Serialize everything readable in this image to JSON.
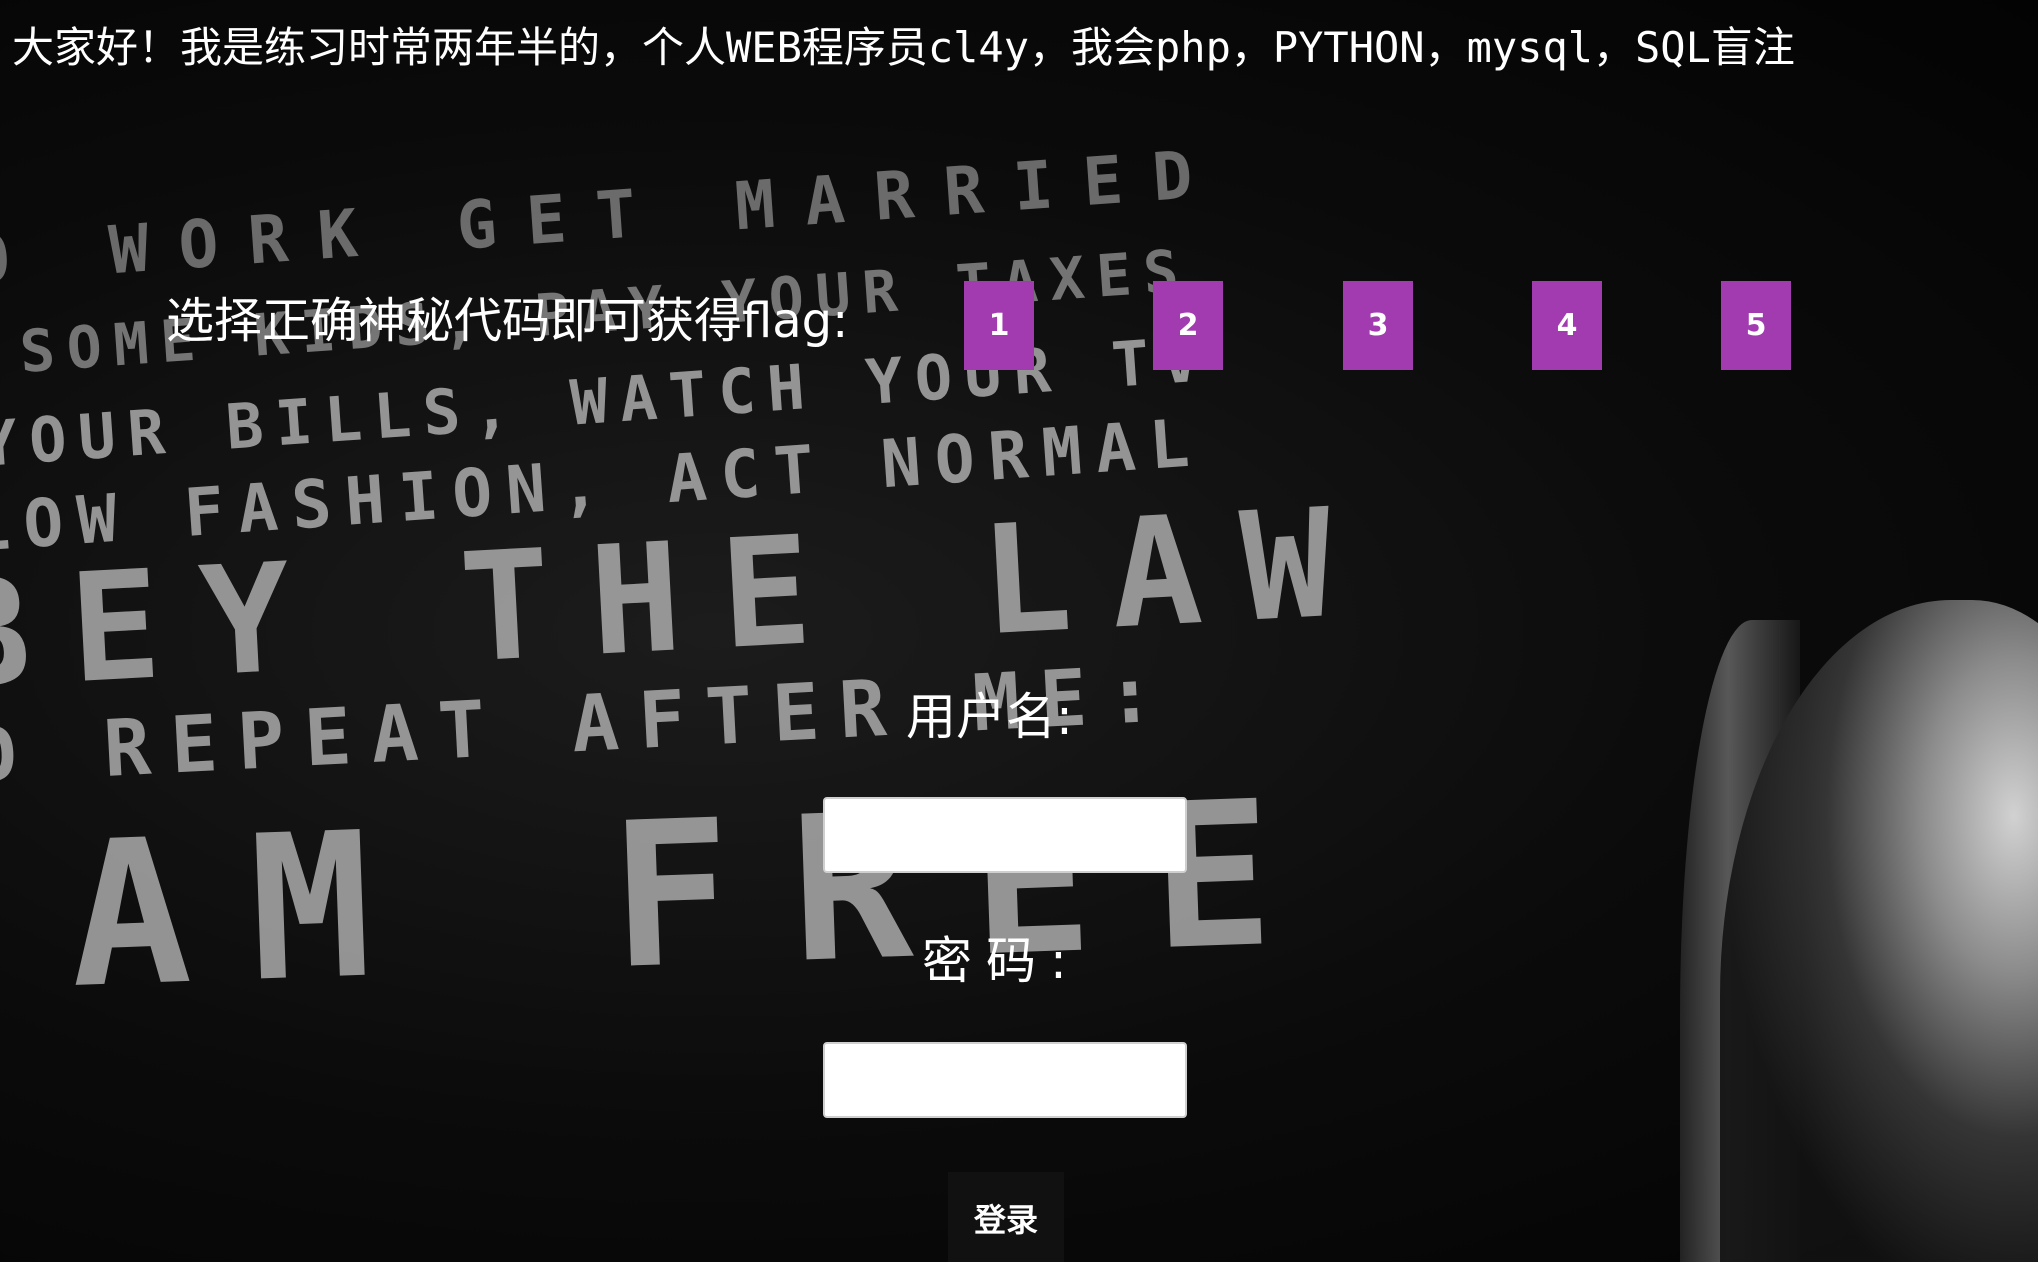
{
  "marquee": {
    "text": "大家好！我是练习时常两年半的，个人WEB程序员cl4y，我会php，PYTHON，mysql，SQL盲注"
  },
  "background": {
    "lines": [
      "O WORK GET MARRIED",
      "SOME KIDS, PAY YOUR TAXES",
      "YOUR BILLS, WATCH YOUR TV",
      "LOW FASHION, ACT NORMAL",
      "BEY THE LAW",
      "D REPEAT AFTER ME:",
      "AM FREE"
    ]
  },
  "flag_chooser": {
    "label": "选择正确神秘代码即可获得flag:",
    "buttons": [
      "1",
      "2",
      "3",
      "4",
      "5"
    ],
    "button_color": "#a23ab0"
  },
  "login_form": {
    "username_label": "用户名:",
    "password_label": "密码:",
    "username_value": "",
    "password_value": "",
    "submit_label": "登录"
  }
}
